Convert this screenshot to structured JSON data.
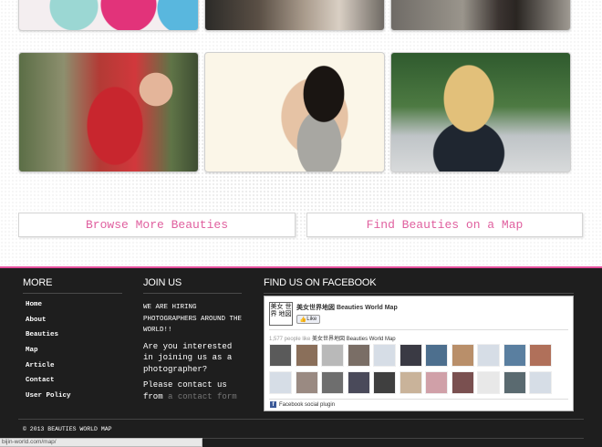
{
  "cta": {
    "browse_label": "Browse More Beauties",
    "map_label": "Find Beauties on a Map"
  },
  "footer": {
    "more": {
      "title": "MORE",
      "items": [
        "Home",
        "About",
        "Beauties",
        "Map",
        "Article",
        "Contact",
        "User Policy"
      ]
    },
    "join": {
      "title": "JOIN US",
      "line1": "WE ARE HIRING PHOTOGRAPHERS AROUND THE WORLD!!",
      "line2": "Are you interested in joining us as a photographer?",
      "line3_prefix": "Please contact us from",
      "line3_link": "a contact form"
    },
    "facebook": {
      "title": "FIND US ON FACEBOOK",
      "page_logo_text": "美女 世界 地図",
      "page_name": "美女世界地図 Beauties World Map",
      "like_label": "Like",
      "likes_count": "1,577 people like",
      "likes_page": "美女世界地図 Beauties World Map",
      "plugin_label": "Facebook social plugin",
      "face_colors": [
        "#5a5a5a",
        "#8a6f5a",
        "#b9b9b9",
        "#7a6e66",
        "#d6dde6",
        "#3a3a44",
        "#4d6f8e",
        "#b98f6a",
        "#d6dde6",
        "#5a7fa0",
        "#b0705a",
        "#d6dde6",
        "#9a8a82",
        "#6e6e6e",
        "#4a4a5a",
        "#3f3f3f",
        "#c9b39a",
        "#d0a0a8",
        "#7a5050",
        "#e8e8e8",
        "#5a6a70",
        "#d6dde6"
      ]
    },
    "copyright": "© 2013 BEAUTIES WORLD MAP"
  },
  "status_url": "bijin-world.com/map/"
}
